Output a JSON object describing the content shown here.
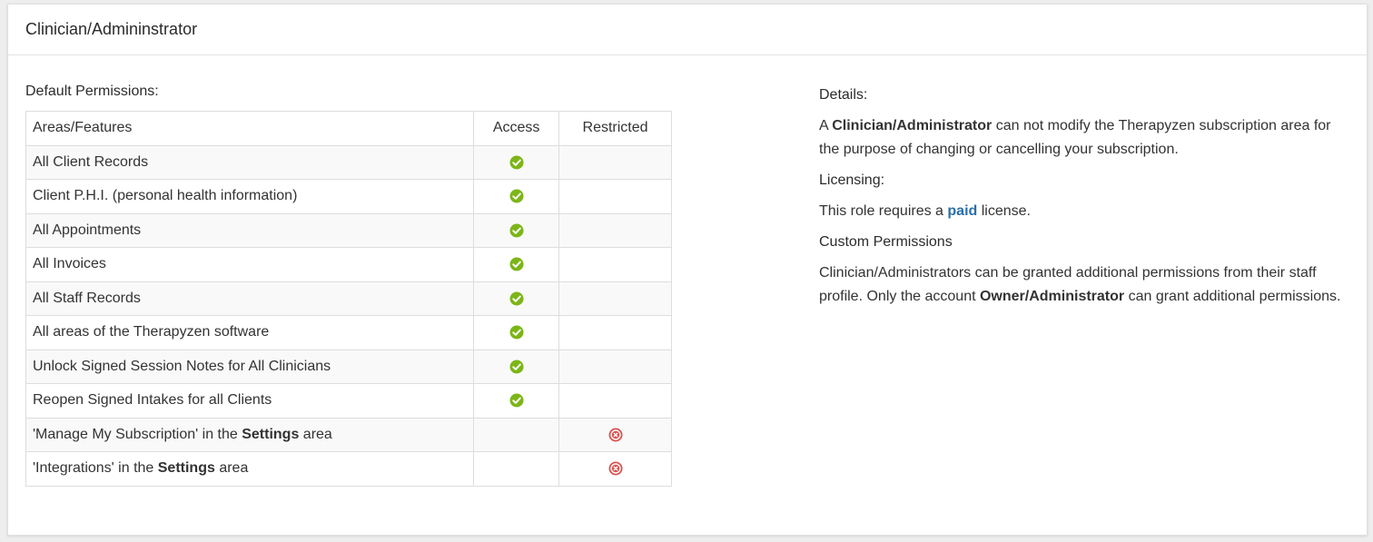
{
  "header": {
    "title": "Clinician/Admininstrator"
  },
  "permissions": {
    "label": "Default Permissions:",
    "columns": [
      "Areas/Features",
      "Access",
      "Restricted"
    ],
    "rows": [
      {
        "pre": "All Client Records",
        "bold": "",
        "post": "",
        "status": "access"
      },
      {
        "pre": "Client P.H.I. (personal health information)",
        "bold": "",
        "post": "",
        "status": "access"
      },
      {
        "pre": "All Appointments",
        "bold": "",
        "post": "",
        "status": "access"
      },
      {
        "pre": "All Invoices",
        "bold": "",
        "post": "",
        "status": "access"
      },
      {
        "pre": "All Staff Records",
        "bold": "",
        "post": "",
        "status": "access"
      },
      {
        "pre": "All areas of the Therapyzen software",
        "bold": "",
        "post": "",
        "status": "access"
      },
      {
        "pre": "Unlock Signed Session Notes for All Clinicians",
        "bold": "",
        "post": "",
        "status": "access"
      },
      {
        "pre": "Reopen Signed Intakes for all Clients",
        "bold": "",
        "post": "",
        "status": "access"
      },
      {
        "pre": "'Manage My Subscription' in the ",
        "bold": "Settings",
        "post": " area",
        "status": "restricted"
      },
      {
        "pre": "'Integrations' in the ",
        "bold": "Settings",
        "post": " area",
        "status": "restricted"
      }
    ]
  },
  "details": {
    "label": "Details:",
    "p1_pre": "A ",
    "p1_bold": "Clinician/Administrator",
    "p1_post": " can not modify the Therapyzen subscription area for the purpose of changing or cancelling your subscription.",
    "licensing_label": "Licensing:",
    "p2_pre": "This role requires a ",
    "p2_link": "paid",
    "p2_post": " license.",
    "custom_label": "Custom Permissions",
    "p3_pre": "Clinician/Administrators can be granted additional permissions from their staff profile. Only the account ",
    "p3_bold": "Owner/Administrator",
    "p3_post": " can grant additional permissions."
  },
  "icons": {
    "access": "check-circle-icon",
    "restricted": "x-circle-icon"
  },
  "colors": {
    "access": "#7cb518",
    "restricted": "#d9534f",
    "link": "#2a6fa8"
  }
}
